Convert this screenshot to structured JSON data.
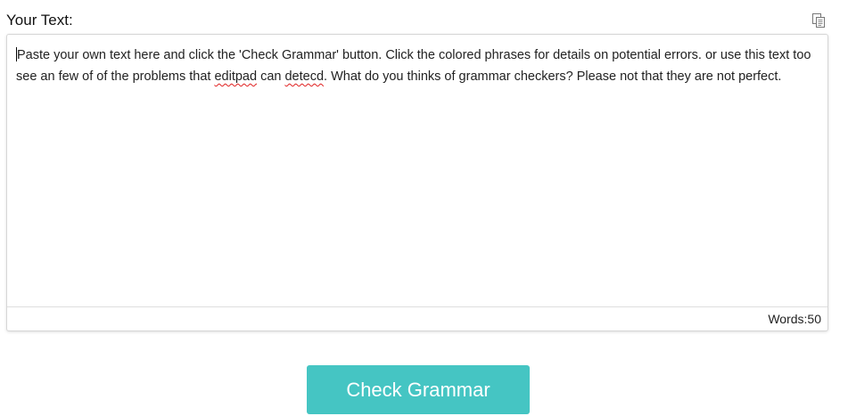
{
  "editor": {
    "title": "Your Text:",
    "copy_icon": "copy-icon",
    "text_segments": [
      {
        "text": "Paste your own text here and click the 'Check Grammar' button. Click the colored phrases for details on potential errors. or use this text too see an few of of the problems that ",
        "error": false
      },
      {
        "text": "editpad",
        "error": true
      },
      {
        "text": " can ",
        "error": false
      },
      {
        "text": "detecd",
        "error": true
      },
      {
        "text": ". What do you thinks of grammar checkers? Please not that they are not perfect.",
        "error": false
      }
    ],
    "word_count_label": "Words:50"
  },
  "actions": {
    "check_grammar_label": "Check Grammar",
    "button_color": "#45c5c3",
    "error_underline_color": "#e02020"
  }
}
